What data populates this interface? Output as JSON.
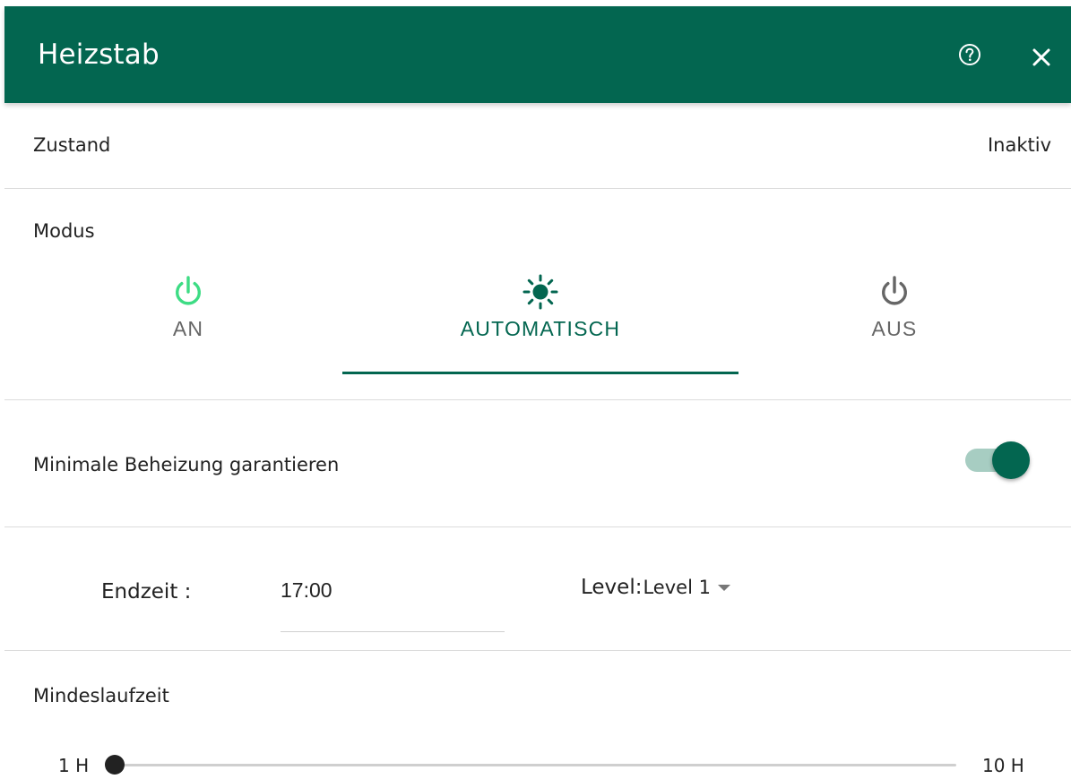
{
  "header": {
    "title": "Heizstab",
    "help_icon": "help-circle-icon",
    "close_icon": "close-icon",
    "background_color": "#036650"
  },
  "status": {
    "label": "Zustand",
    "value": "Inaktiv"
  },
  "mode": {
    "label": "Modus",
    "tabs": [
      {
        "label": "AN",
        "icon": "power-icon",
        "icon_color": "#3ddc84",
        "selected": false
      },
      {
        "label": "AUTOMATISCH",
        "icon": "sun-icon",
        "icon_color": "#036650",
        "selected": true
      },
      {
        "label": "AUS",
        "icon": "power-icon",
        "icon_color": "#666666",
        "selected": false
      }
    ],
    "accent_color": "#036650"
  },
  "min_heating": {
    "label": "Minimale Beheizung garantieren",
    "enabled": true
  },
  "schedule": {
    "end_time_label": "Endzeit :",
    "end_time_value": "17:00",
    "level_label": "Level:",
    "level_value": "Level 1"
  },
  "min_runtime": {
    "label": "Mindeslaufzeit",
    "min_label": "1 H",
    "max_label": "10 H",
    "value_fraction": 0.0
  }
}
